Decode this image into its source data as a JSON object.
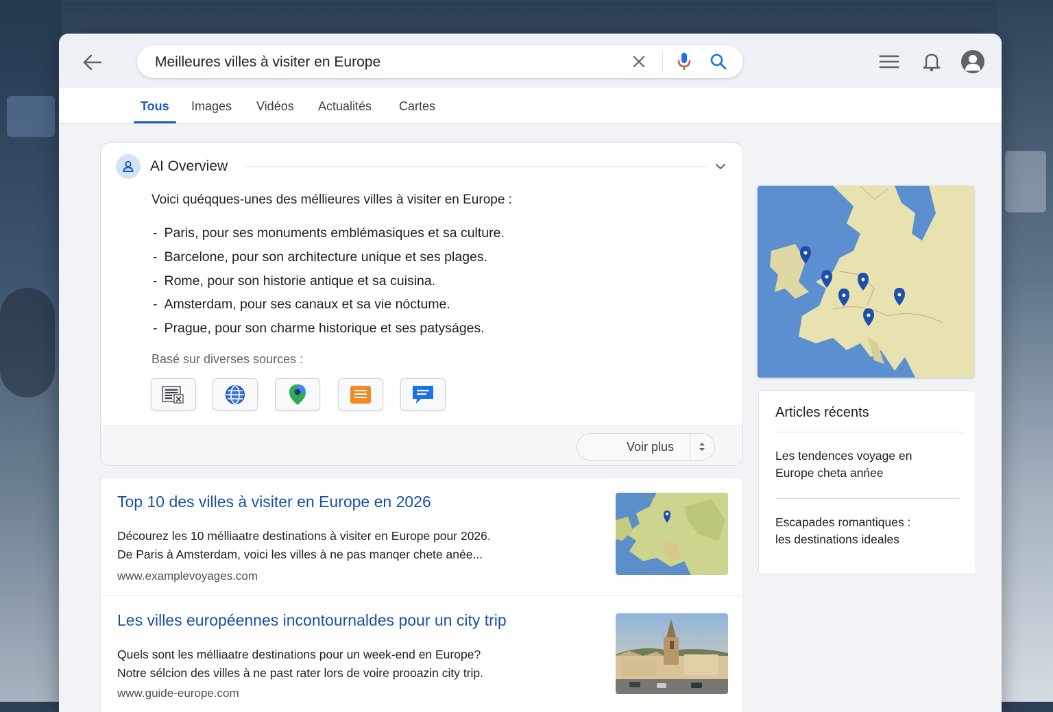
{
  "search": {
    "query": "Meilleures villes à visiter en Europe"
  },
  "icons": {
    "back": "arrow-left-icon",
    "clear": "close-icon",
    "mic": "microphone-icon",
    "search": "search-icon",
    "menu": "hamburger-menu-icon",
    "notifications": "bell-icon",
    "account": "user-avatar-icon"
  },
  "tabs": [
    {
      "label": "Tous",
      "active": true
    },
    {
      "label": "Images",
      "active": false
    },
    {
      "label": "Vidéos",
      "active": false
    },
    {
      "label": "Actualités",
      "active": false
    },
    {
      "label": "Cartes",
      "active": false
    }
  ],
  "ai_overview": {
    "title": "AI Overview",
    "intro": "Voici quéqques-unes des méllieures villes à visiter en Europe :",
    "items": [
      {
        "city": "Paris",
        "text": ", pour ses monuments emblémasiques et sa culture."
      },
      {
        "city": "Barcelone",
        "text": ", pour son architecture unique et ses plages."
      },
      {
        "city": "Rome",
        "text": ", pour son historie antique et sa cuisina."
      },
      {
        "city": "Amsterdam",
        "text": ", pour ses canaux et sa vie nóctume."
      },
      {
        "city": "Prague",
        "text": ", pour son charme historique et ses patyságes."
      }
    ],
    "sources_label": "Basé sur diverses sources :",
    "sources": [
      "news-source-icon",
      "globe-source-icon",
      "map-pin-source-icon",
      "document-source-icon",
      "chat-source-icon"
    ],
    "more_label": "Voir plus"
  },
  "results": [
    {
      "title": "Top 10 des villes à visiter en Europe en 2026",
      "snippet_line1": "Décourez les 10 mélliaatre destinations à visiter en Europe pour 2026.",
      "snippet_line2": "De Paris à Amsterdam, voici les villes à ne pas manqer chete anée...",
      "url": "www.examplevoyages.com",
      "thumbnail": "europe-map-thumbnail"
    },
    {
      "title": "Les villes européennes incontournaldes pour un city trip",
      "snippet_line1": "Quels sont les mélliaatre destinations pour un week-end en Europe?",
      "snippet_line2": "Notre sélcion des villes à ne past rater lors de voire prooazin city trip.",
      "url": "www.guide-europe.com",
      "thumbnail": "city-cathedral-photo"
    }
  ],
  "sidebar": {
    "map": "europe-map-with-pins",
    "articles_title": "Articles récents",
    "articles": [
      {
        "line1": "Les tendences voyage en",
        "line2": "Europe cheta anńee"
      },
      {
        "line1": "Escapades romantiques :",
        "line2": "les destinations ideales"
      }
    ]
  },
  "colors": {
    "accent": "#1a5fb4",
    "link": "#1a4fa8",
    "map_water": "#5b8fd0",
    "map_land": "#e8e1b0",
    "pin": "#1f4fae"
  }
}
